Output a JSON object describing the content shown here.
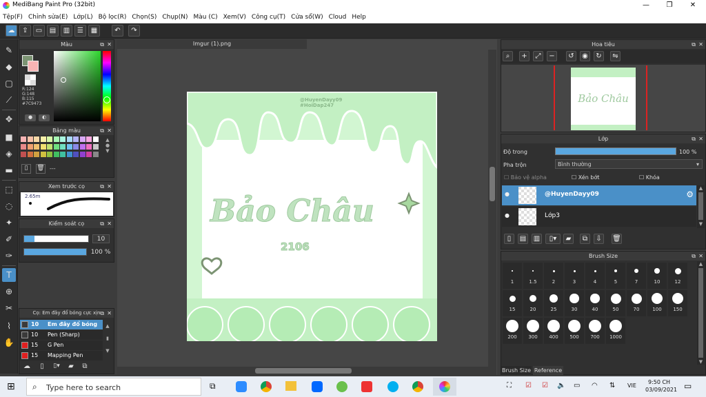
{
  "window": {
    "title": "MediBang Paint Pro (32bit)"
  },
  "menu": [
    "Tệp(F)",
    "Chỉnh sửa(E)",
    "Lớp(L)",
    "Bộ lọc(R)",
    "Chọn(S)",
    "Chụp(N)",
    "Màu (C)",
    "Xem(V)",
    "Công cụ(T)",
    "Cửa sổ(W)",
    "Cloud",
    "Help"
  ],
  "color_panel": {
    "title": "Màu",
    "r": "R:124",
    "g": "G:148",
    "b": "B:115",
    "hex": "#7C9473"
  },
  "palette_panel": {
    "title": "Bảng màu",
    "name": "---"
  },
  "brush_preview": {
    "title": "Xem trước cọ",
    "size": "2.65m"
  },
  "brush_control": {
    "title": "Kiểm soát cọ",
    "size": "10",
    "opacity": "100 %",
    "opacity_level": 1.0
  },
  "brush_list": {
    "title": "Cọ: Em đây đổ bóng cực xịn",
    "items": [
      {
        "size": "10",
        "name": "Em đây đổ bóng",
        "color": "#3a3a3a",
        "selected": true
      },
      {
        "size": "10",
        "name": "Pen (Sharp)",
        "color": "#3a3a3a",
        "selected": false
      },
      {
        "size": "15",
        "name": "G Pen",
        "color": "#e02020",
        "selected": false
      },
      {
        "size": "15",
        "name": "Mapping Pen",
        "color": "#e02020",
        "selected": false
      }
    ]
  },
  "canvas": {
    "tab": "Imgur (1).png",
    "doc": {
      "credit1": "@HuyenDayy09",
      "credit2": "#HoiDap247",
      "name": "Bảo Châu",
      "sub": "2106"
    }
  },
  "navigator": {
    "title": "Hoa tiêu"
  },
  "layers": {
    "title": "Lớp",
    "opacity_label": "Độ trong",
    "opacity_value": "100 %",
    "opacity_level": 1.0,
    "blend_label": "Pha trộn",
    "blend_value": "Bình thường",
    "protect_alpha": "Bảo vệ alpha",
    "clip": "Xén bớt",
    "lock": "Khóa",
    "items": [
      {
        "name": "@HuyenDayy09",
        "selected": true
      },
      {
        "name": "Lớp3",
        "selected": false
      }
    ]
  },
  "brush_size": {
    "title": "Brush Size",
    "sizes": [
      "1",
      "1.5",
      "2",
      "3",
      "4",
      "5",
      "7",
      "10",
      "12",
      "15",
      "20",
      "25",
      "30",
      "40",
      "50",
      "70",
      "100",
      "150",
      "200",
      "300",
      "400",
      "500",
      "700",
      "1000"
    ],
    "tab1": "Brush Size",
    "tab2": "Reference"
  },
  "taskbar": {
    "search": "Type here to search",
    "lang": "VIE",
    "time": "9:50 CH",
    "date": "03/09/2021"
  }
}
